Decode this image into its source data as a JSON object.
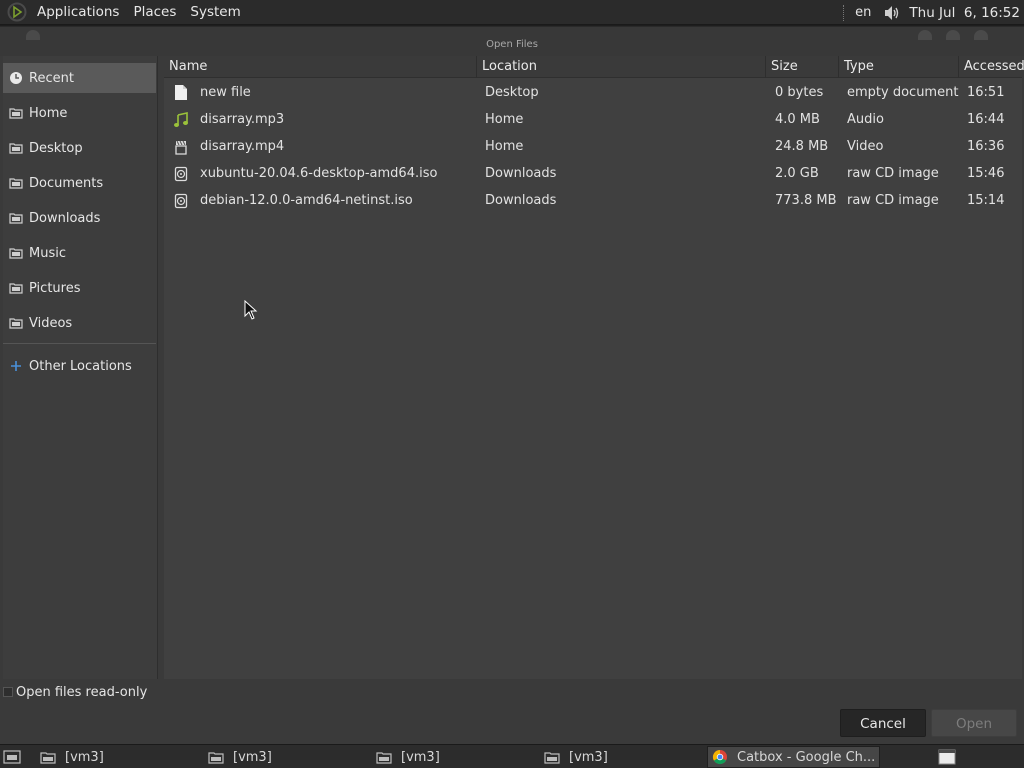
{
  "top_panel": {
    "menus": [
      "Applications",
      "Places",
      "System"
    ],
    "language": "en",
    "clock": "Thu Jul  6, 16:52"
  },
  "dialog": {
    "title": "Open Files",
    "readonly_label": "Open files read-only",
    "cancel_label": "Cancel",
    "open_label": "Open"
  },
  "sidebar": {
    "items": [
      {
        "label": "Recent",
        "icon": "recent-icon"
      },
      {
        "label": "Home",
        "icon": "folder-icon"
      },
      {
        "label": "Desktop",
        "icon": "folder-icon"
      },
      {
        "label": "Documents",
        "icon": "folder-icon"
      },
      {
        "label": "Downloads",
        "icon": "folder-icon"
      },
      {
        "label": "Music",
        "icon": "folder-icon"
      },
      {
        "label": "Pictures",
        "icon": "folder-icon"
      },
      {
        "label": "Videos",
        "icon": "folder-icon"
      }
    ],
    "other_locations": "Other Locations"
  },
  "columns": {
    "name": "Name",
    "location": "Location",
    "size": "Size",
    "type": "Type",
    "accessed": "Accessed"
  },
  "files": [
    {
      "name": "new file",
      "location": "Desktop",
      "size": "0 bytes",
      "type": "empty document",
      "accessed": "16:51",
      "icon": "document-icon"
    },
    {
      "name": "disarray.mp3",
      "location": "Home",
      "size": "4.0 MB",
      "type": "Audio",
      "accessed": "16:44",
      "icon": "audio-file-icon"
    },
    {
      "name": "disarray.mp4",
      "location": "Home",
      "size": "24.8 MB",
      "type": "Video",
      "accessed": "16:36",
      "icon": "video-file-icon"
    },
    {
      "name": "xubuntu-20.04.6-desktop-amd64.iso",
      "location": "Downloads",
      "size": "2.0 GB",
      "type": "raw CD image",
      "accessed": "15:46",
      "icon": "disc-image-icon"
    },
    {
      "name": "debian-12.0.0-amd64-netinst.iso",
      "location": "Downloads",
      "size": "773.8 MB",
      "type": "raw CD image",
      "accessed": "15:14",
      "icon": "disc-image-icon"
    }
  ],
  "taskbar": {
    "tasks": [
      "[vm3]",
      "[vm3]",
      "[vm3]",
      "[vm3]"
    ],
    "active_task": "Catbox - Google Ch..."
  },
  "colors": {
    "active_row": "#5a5a5a",
    "audio_icon": "#9bc23a",
    "accent_blue": "#4a90d9"
  }
}
